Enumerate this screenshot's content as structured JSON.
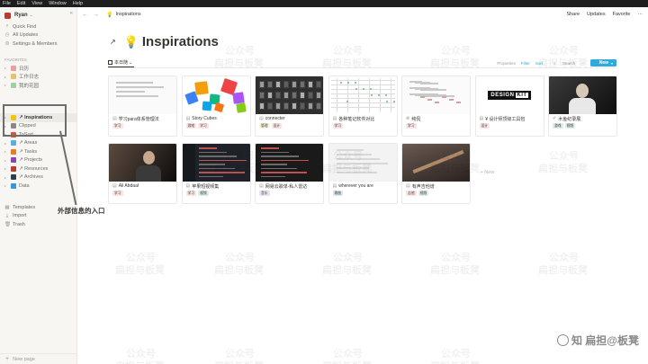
{
  "os_menu": [
    "File",
    "Edit",
    "View",
    "Window",
    "Help"
  ],
  "workspace": {
    "name": "Ryan",
    "chevron": "⌄",
    "close": "«"
  },
  "sidebar": {
    "top_items": [
      {
        "icon": "search-icon",
        "glyph": "⌕",
        "label": "Quick Find"
      },
      {
        "icon": "clock-icon",
        "glyph": "◷",
        "label": "All Updates"
      },
      {
        "icon": "gear-icon",
        "glyph": "⚙",
        "label": "Settings & Members"
      }
    ],
    "favorites_label": "FAVORITES",
    "favorites": [
      {
        "label": "日历",
        "color": "#e8a0a0"
      },
      {
        "label": "工作日志",
        "color": "#e8c070"
      },
      {
        "label": "我的花园",
        "color": "#9fd09f"
      }
    ],
    "workspace_items": [
      {
        "label": "↗ Inspirations",
        "color": "#f1c40f",
        "active": true
      },
      {
        "label": "Clipped",
        "color": "#888888",
        "active": false
      },
      {
        "label": "ToSort",
        "color": "#e74c3c",
        "active": false
      },
      {
        "label": "↗ Areas",
        "color": "#5dade2",
        "active": false
      },
      {
        "label": "↗ Tasks",
        "color": "#e67e22",
        "active": false
      },
      {
        "label": "↗ Projects",
        "color": "#8e44ad",
        "active": false
      },
      {
        "label": "↗ Resources",
        "color": "#c0392b",
        "active": false
      },
      {
        "label": "↗ Archives",
        "color": "#2c3e50",
        "active": false
      },
      {
        "label": "Data",
        "color": "#3498db",
        "active": false
      }
    ],
    "bottom_items": [
      {
        "icon": "template-icon",
        "glyph": "▦",
        "label": "Templates"
      },
      {
        "icon": "import-icon",
        "glyph": "⤓",
        "label": "Import"
      },
      {
        "icon": "trash-icon",
        "glyph": "🗑",
        "label": "Trash"
      }
    ],
    "new_page": "New page"
  },
  "annotation": {
    "text": "外部信息的入口"
  },
  "topbar": {
    "breadcrumb": "Inspirations",
    "share": "Share",
    "updates": "Updates",
    "favorite": "Favorite",
    "more": "···"
  },
  "page": {
    "title": "Inspirations",
    "view_name": "本日随",
    "controls": {
      "properties": "Properties",
      "filter": "Filter",
      "sort": "Sort",
      "search": "Search",
      "more": "···",
      "new": "New"
    },
    "new_card_label": "+ New"
  },
  "cards": [
    {
      "title": "学习para体系管理法",
      "pg": "▤",
      "thumb": "text",
      "tags": [
        {
          "label": "学习",
          "c": "t-red"
        }
      ]
    },
    {
      "title": "Story Cubes",
      "pg": "▤",
      "thumb": "cubes",
      "tags": [
        {
          "label": "游戏",
          "c": "t-red"
        },
        {
          "label": "学习",
          "c": "t-red"
        }
      ]
    },
    {
      "title": "connecter",
      "pg": "▤",
      "thumb": "dark-grid",
      "tags": [
        {
          "label": "管理",
          "c": "t-yellow"
        },
        {
          "label": "设计",
          "c": "t-red"
        }
      ]
    },
    {
      "title": "各种笔记软件对比",
      "pg": "▤",
      "thumb": "sheet",
      "tags": [
        {
          "label": "学习",
          "c": "t-red"
        }
      ]
    },
    {
      "title": "纯侃",
      "pg": "⊗",
      "thumb": "chart",
      "tags": [
        {
          "label": "学习",
          "c": "t-red"
        }
      ]
    },
    {
      "title": "¥ 设计师顶级工具包",
      "pg": "▤",
      "thumb": "designkit",
      "tags": [
        {
          "label": "设计",
          "c": "t-red"
        }
      ]
    },
    {
      "title": "木鱼纪录展",
      "pg": "✐",
      "thumb": "photo",
      "tags": [
        {
          "label": "游戏",
          "c": "t-green"
        },
        {
          "label": "视频",
          "c": "t-green"
        }
      ]
    },
    {
      "title": "Ali Abdaal",
      "pg": "▤",
      "thumb": "photo2",
      "tags": [
        {
          "label": "学习",
          "c": "t-red"
        }
      ]
    },
    {
      "title": "苹果短视频集",
      "pg": "▤",
      "thumb": "code",
      "tags": [
        {
          "label": "学习",
          "c": "t-red"
        },
        {
          "label": "视频",
          "c": "t-green"
        }
      ]
    },
    {
      "title": "网易云歌单-私人雷达",
      "pg": "▤",
      "thumb": "code2",
      "tags": [
        {
          "label": "音乐",
          "c": "t-purple"
        }
      ]
    },
    {
      "title": "wherever you are",
      "pg": "▤",
      "thumb": "blur",
      "tags": [
        {
          "label": "歌曲",
          "c": "t-blue"
        }
      ]
    },
    {
      "title": "有声吉他谱",
      "pg": "▤",
      "thumb": "guitar",
      "tags": [
        {
          "label": "吉他",
          "c": "t-red"
        },
        {
          "label": "视频",
          "c": "t-green"
        }
      ]
    }
  ],
  "watermark": {
    "line1": "公众号",
    "line2": "扁担与板凳",
    "corner": "知 扁担@板凳"
  }
}
